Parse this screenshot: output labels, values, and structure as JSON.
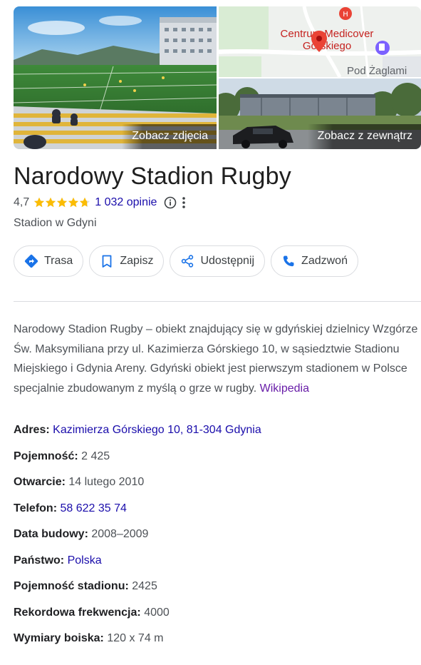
{
  "media": {
    "photos_label": "Zobacz zdjęcia",
    "outside_label": "Zobacz z zewnątrz",
    "map": {
      "place_label_line1": "Centrum Medicover",
      "place_label_line2": "Górskiego",
      "area_label": "Pod Żaglami"
    }
  },
  "place": {
    "title": "Narodowy Stadion Rugby",
    "rating": "4,7",
    "rating_stars": 4.7,
    "reviews": "1 032 opinie",
    "category": "Stadion w Gdyni"
  },
  "actions": [
    {
      "label": "Trasa",
      "icon": "directions-icon"
    },
    {
      "label": "Zapisz",
      "icon": "bookmark-icon"
    },
    {
      "label": "Udostępnij",
      "icon": "share-icon"
    },
    {
      "label": "Zadzwoń",
      "icon": "phone-icon"
    }
  ],
  "description": {
    "text": "Narodowy Stadion Rugby – obiekt znajdujący się w gdyńskiej dzielnicy Wzgórze Św. Maksymiliana przy ul. Kazimierza Górskiego 10, w sąsiedztwie Stadionu Miejskiego i Gdynia Areny. Gdyński obiekt jest pierwszym stadionem w Polsce specjalnie zbudowanym z myślą o grze w rugby.",
    "source": "Wikipedia"
  },
  "facts": [
    {
      "key": "Adres:",
      "value": "Kazimierza Górskiego 10, 81-304 Gdynia",
      "link": true
    },
    {
      "key": "Pojemność:",
      "value": "2 425",
      "link": false
    },
    {
      "key": "Otwarcie:",
      "value": "14 lutego 2010",
      "link": false
    },
    {
      "key": "Telefon:",
      "value": "58 622 35 74",
      "link": true
    },
    {
      "key": "Data budowy:",
      "value": "2008–2009",
      "link": false
    },
    {
      "key": "Państwo:",
      "value": "Polska",
      "link": true
    },
    {
      "key": "Pojemność stadionu:",
      "value": "2425",
      "link": false
    },
    {
      "key": "Rekordowa frekwencja:",
      "value": "4000",
      "link": false
    },
    {
      "key": "Wymiary boiska:",
      "value": "120 x 74 m",
      "link": false
    }
  ],
  "colors": {
    "link": "#1a0dab",
    "visited_link": "#681da8",
    "star": "#fbbc04",
    "accent_icon": "#1a73e8",
    "map_pin": "#ea4335"
  }
}
